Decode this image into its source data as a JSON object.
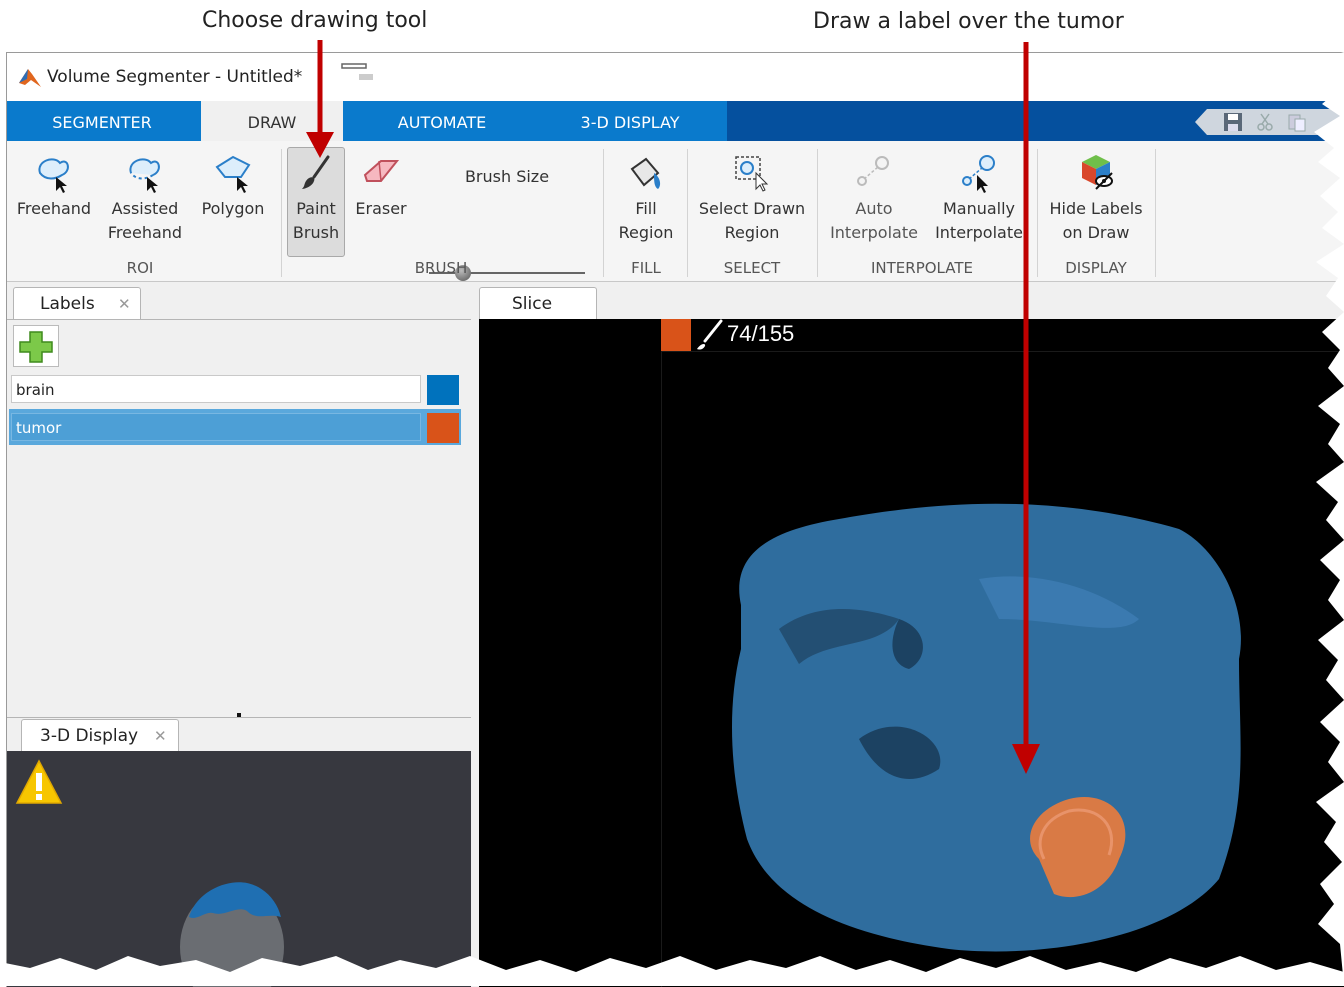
{
  "callouts": {
    "choose_tool": "Choose drawing tool",
    "draw_label": "Draw a label over the tumor"
  },
  "window": {
    "title": "Volume Segmenter - Untitled*"
  },
  "tabs": [
    {
      "label": "SEGMENTER",
      "active": false
    },
    {
      "label": "DRAW",
      "active": true
    },
    {
      "label": "AUTOMATE",
      "active": false
    },
    {
      "label": "3-D DISPLAY",
      "active": false
    }
  ],
  "ribbon": {
    "roi": {
      "group": "ROI",
      "freehand": [
        "Freehand"
      ],
      "assisted": [
        "Assisted",
        "Freehand"
      ],
      "polygon": [
        "Polygon"
      ]
    },
    "brush": {
      "group": "BRUSH",
      "paint": [
        "Paint",
        "Brush"
      ],
      "eraser": [
        "Eraser"
      ],
      "size_label": "Brush Size",
      "size_value": 0.22
    },
    "fill": {
      "group": "FILL",
      "fill_region": [
        "Fill",
        "Region"
      ]
    },
    "select": {
      "group": "SELECT",
      "select_drawn": [
        "Select Drawn",
        "Region"
      ]
    },
    "interpolate": {
      "group": "INTERPOLATE",
      "auto": [
        "Auto",
        "Interpolate"
      ],
      "manual": [
        "Manually",
        "Interpolate"
      ]
    },
    "display": {
      "group": "DISPLAY",
      "hide": [
        "Hide Labels",
        "on Draw"
      ]
    }
  },
  "labels_panel": {
    "tab": "Labels",
    "items": [
      {
        "name": "brain",
        "color": "#0072bd",
        "selected": false
      },
      {
        "name": "tumor",
        "color": "#d95319",
        "selected": true
      }
    ]
  },
  "display_panel": {
    "tab": "3-D Display"
  },
  "slice_panel": {
    "tab": "Slice",
    "slice_counter": "74/155",
    "active_color": "#d95319"
  }
}
